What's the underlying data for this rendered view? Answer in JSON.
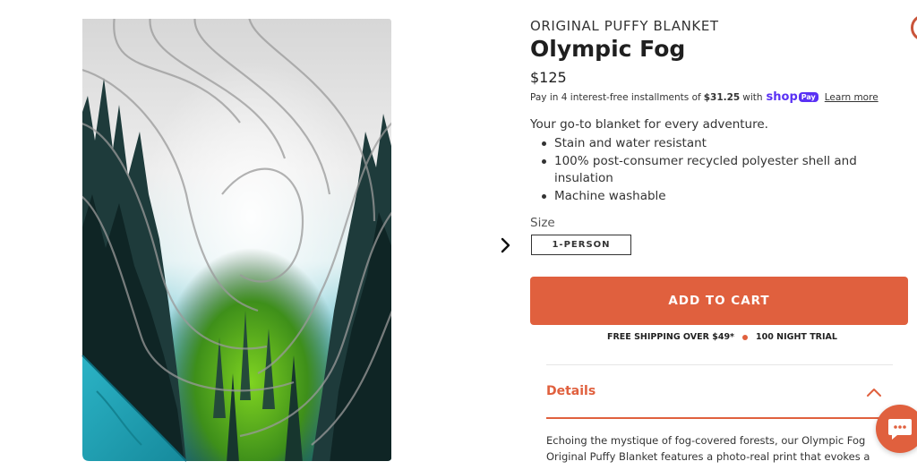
{
  "product": {
    "eyebrow": "ORIGINAL PUFFY BLANKET",
    "title": "Olympic Fog",
    "price": "$125",
    "installments": {
      "prefix": "Pay in 4 interest-free installments of",
      "amount": "$31.25",
      "with": "with",
      "brand": "shop",
      "badge": "Pay",
      "learn_more": "Learn more"
    },
    "description": "Your go-to blanket for every adventure.",
    "features": [
      "Stain and water resistant",
      "100% post-consumer recycled polyester shell and insulation",
      "Machine washable"
    ],
    "size": {
      "label": "Size",
      "selected": "1-PERSON"
    },
    "add_to_cart": "ADD TO CART",
    "perks": [
      "FREE SHIPPING OVER $49*",
      "100 NIGHT TRIAL"
    ],
    "details": {
      "title": "Details",
      "body": "Echoing the mystique of fog-covered forests, our Olympic Fog Original Puffy Blanket features a photo-real print that evokes a"
    }
  },
  "icons": {
    "next": "chevron-right-icon",
    "details_toggle": "chevron-up-icon",
    "chat": "chat-icon"
  },
  "colors": {
    "accent": "#e0603e",
    "shop_pay": "#5a31f4",
    "blanket_underside": "#1aa3b8"
  }
}
